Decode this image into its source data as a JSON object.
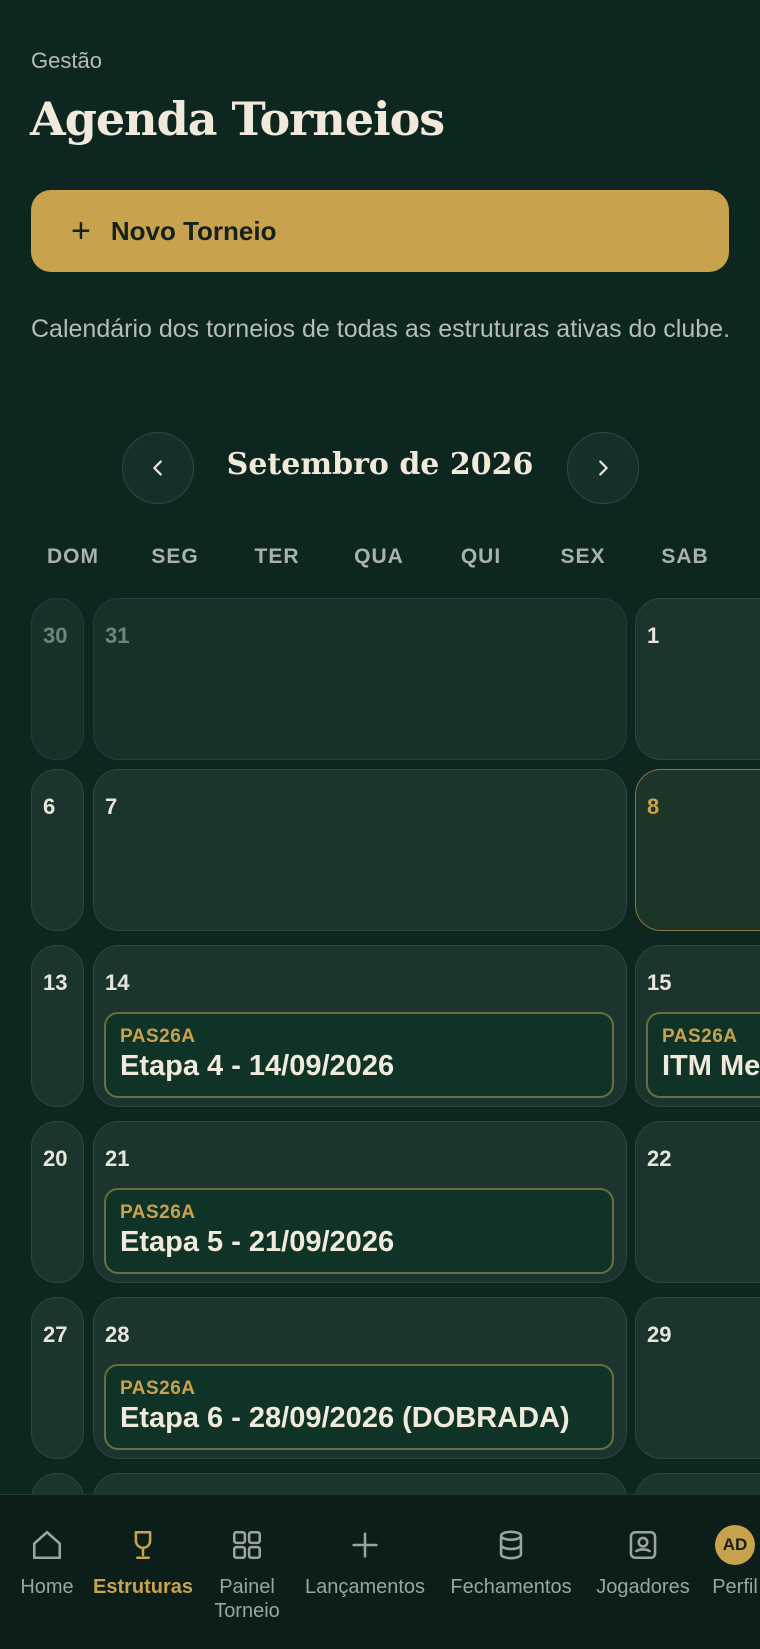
{
  "header": {
    "eyebrow": "Gestão",
    "title": "Agenda Torneios"
  },
  "new_button": {
    "label": "Novo Torneio"
  },
  "description": "Calendário dos torneios de todas as estruturas ativas do clube.",
  "calendar": {
    "month_label": "Setembro de 2026",
    "weekdays": [
      "DOM",
      "SEG",
      "TER",
      "QUA",
      "QUI",
      "SEX",
      "SAB"
    ],
    "weeks": [
      {
        "dom": "30",
        "seg": "31",
        "sab": "1"
      },
      {
        "dom": "6",
        "seg": "7",
        "sab": "8"
      },
      {
        "dom": "13",
        "seg": "14",
        "sab": "15"
      },
      {
        "dom": "20",
        "seg": "21",
        "sab": "22"
      },
      {
        "dom": "27",
        "seg": "28",
        "sab": "29"
      }
    ],
    "events": [
      {
        "code": "PAS26A",
        "name": "Etapa 4 - 14/09/2026"
      },
      {
        "code": "PAS26A",
        "name": "ITM Me"
      },
      {
        "code": "PAS26A",
        "name": "Etapa 5 - 21/09/2026"
      },
      {
        "code": "PAS26A",
        "name": "Etapa 6 - 28/09/2026 (DOBRADA)"
      }
    ]
  },
  "tabbar": {
    "items": [
      {
        "label": "Home",
        "icon": "home-icon"
      },
      {
        "label": "Estruturas",
        "icon": "trophy-icon"
      },
      {
        "label": "Painel Torneio",
        "icon": "grid-icon"
      },
      {
        "label": "Lançamentos",
        "icon": "plus-icon"
      },
      {
        "label": "Fechamentos",
        "icon": "database-icon"
      },
      {
        "label": "Jogadores",
        "icon": "user-badge-icon"
      },
      {
        "label": "Perfil",
        "icon": "avatar-icon",
        "avatar_text": "AD"
      }
    ],
    "active": "Estruturas"
  },
  "colors": {
    "background": "#0e2620",
    "accent": "#c8a24c",
    "cell": "#1b342d"
  }
}
